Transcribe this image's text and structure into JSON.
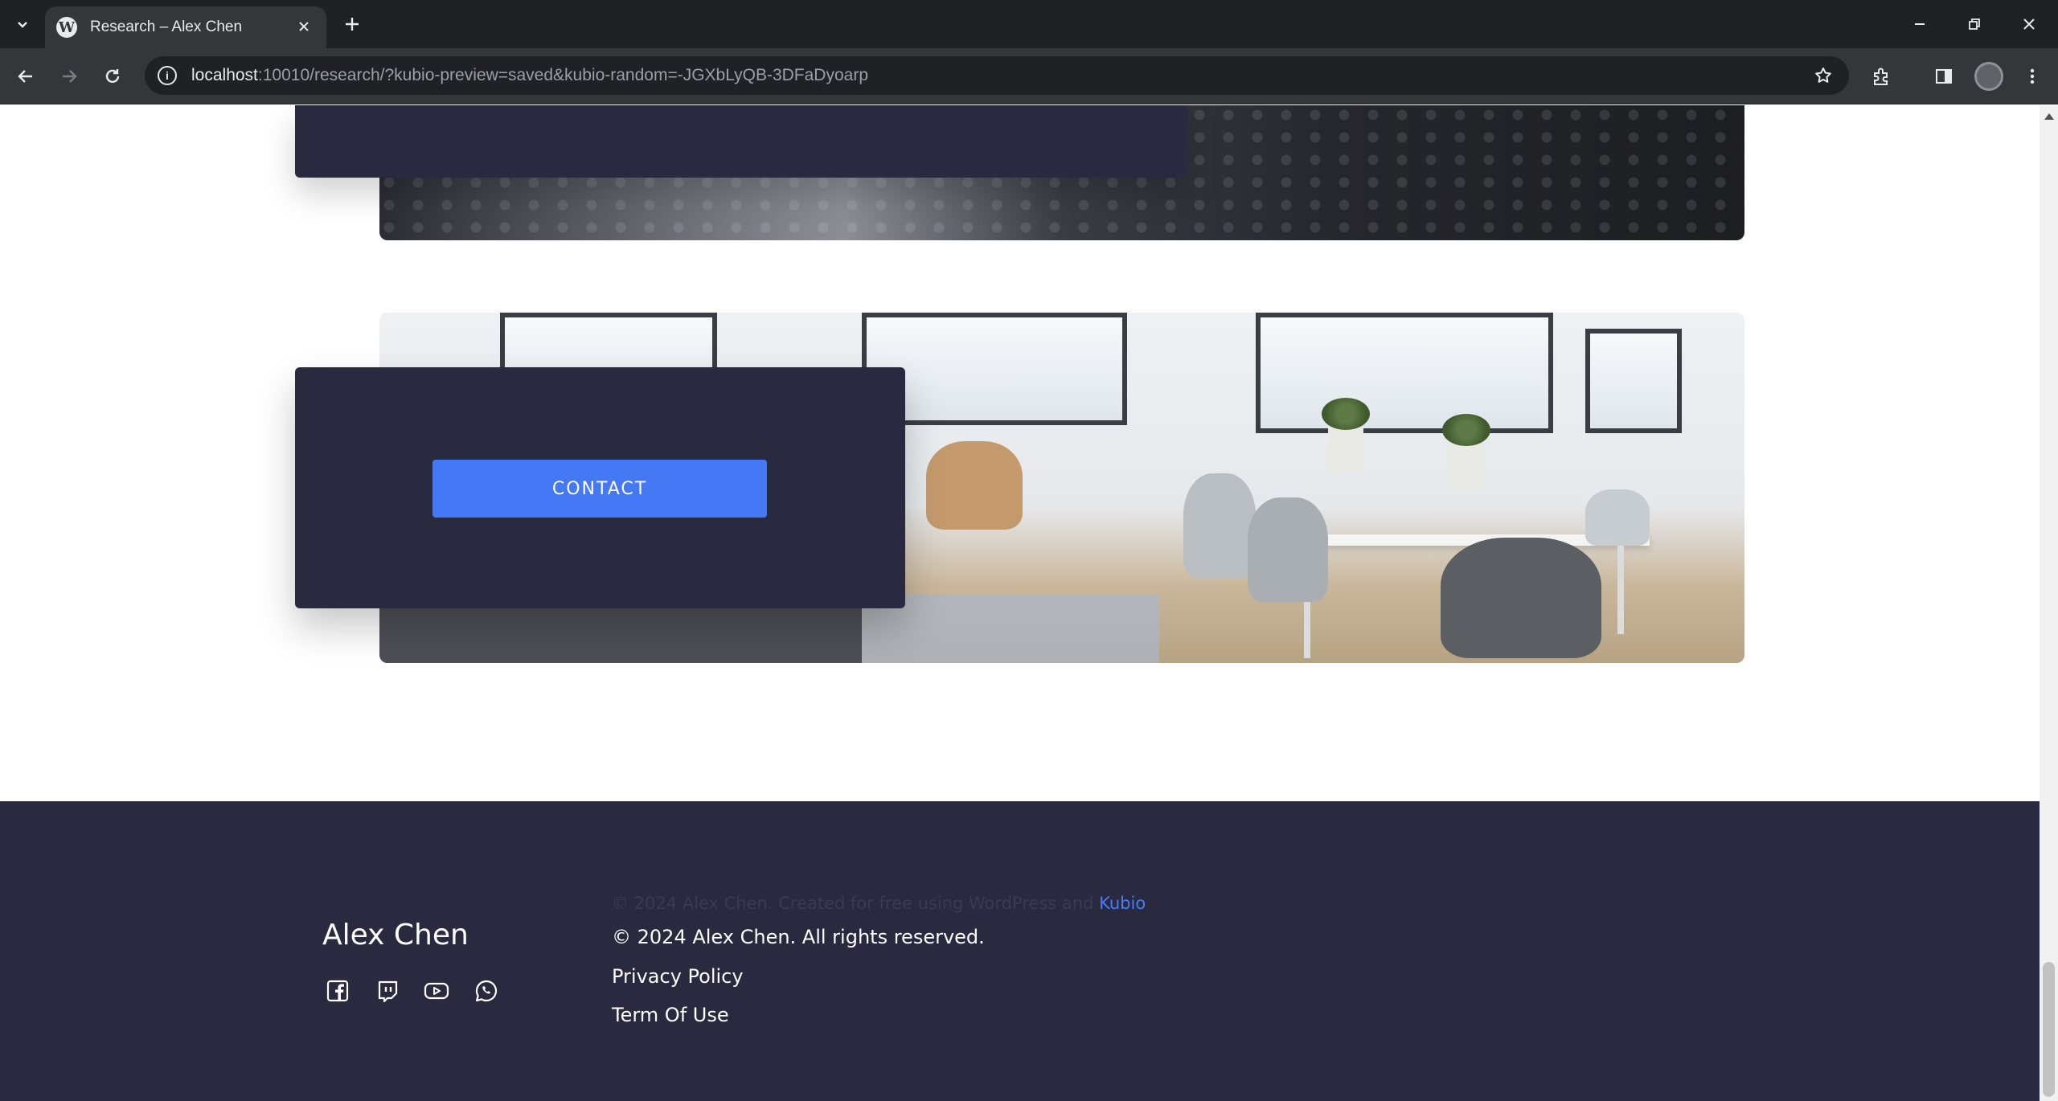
{
  "browser": {
    "tab_title": "Research – Alex Chen",
    "url_host": "localhost",
    "url_rest": ":10010/research/?kubio-preview=saved&kubio-random=-JGXbLyQB-3DFaDyoarp"
  },
  "section": {
    "contact_label": "CONTACT"
  },
  "footer": {
    "credit_prefix": "© 2024 Alex Chen. Created for free using WordPress and ",
    "credit_link": "Kubio",
    "brand": "Alex Chen",
    "copyright": "© 2024 Alex Chen. All rights reserved.",
    "privacy": "Privacy Policy",
    "terms": "Term Of Use",
    "social_icons": [
      "facebook-icon",
      "twitch-icon",
      "youtube-icon",
      "whatsapp-icon"
    ]
  },
  "colors": {
    "card": "#292a3f",
    "accent": "#4478f5",
    "chrome_dark": "#202124",
    "chrome_toolbar": "#35363a"
  }
}
